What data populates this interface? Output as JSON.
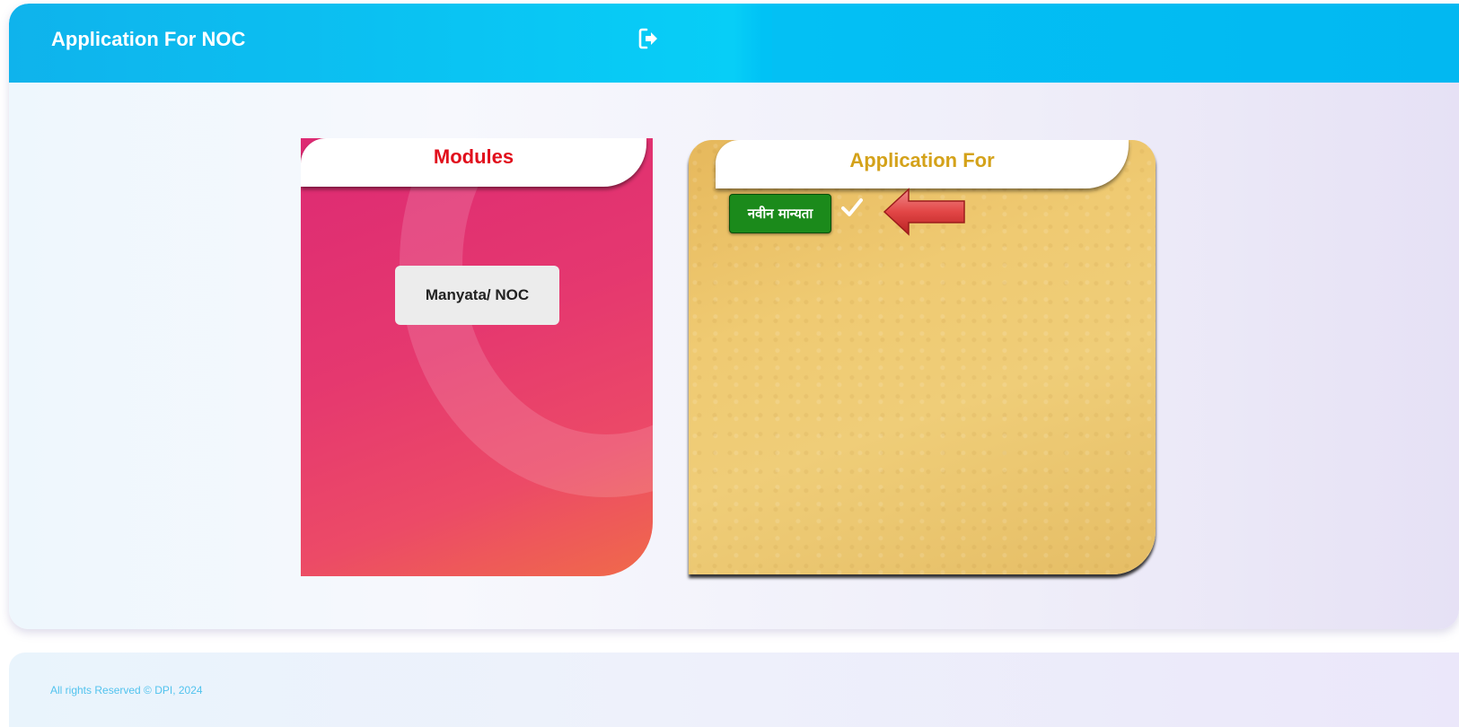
{
  "header": {
    "title": "Application For NOC",
    "logout_icon": "logout-icon"
  },
  "modules_card": {
    "title": "Modules",
    "items": [
      {
        "label": "Manyata/ NOC"
      }
    ],
    "colors": {
      "title": "#e10f1c",
      "background": "#e5386f"
    }
  },
  "application_card": {
    "title": "Application For",
    "options": [
      {
        "label": "नवीन मान्यता",
        "selected": true,
        "icon": "check-icon"
      }
    ],
    "pointer_icon": "arrow-left-icon",
    "colors": {
      "title": "#d4a21a",
      "option_bg": "#1b8a1b",
      "background": "#efca72"
    }
  },
  "footer": {
    "text": "All rights Reserved © DPI, 2024"
  },
  "colors": {
    "header": "#07cef7",
    "footer_text": "#52c3ee"
  }
}
